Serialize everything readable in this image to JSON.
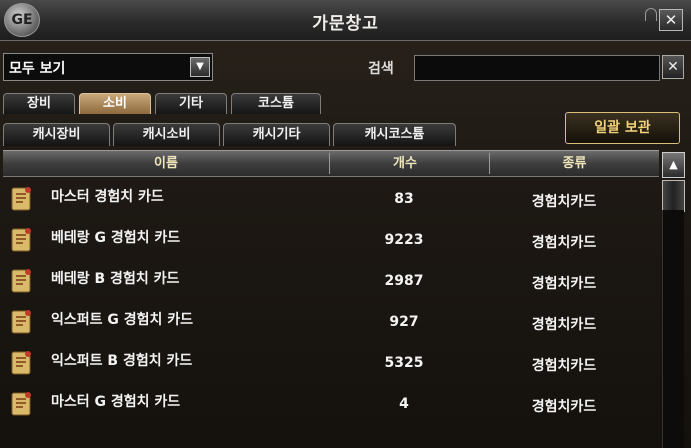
{
  "window": {
    "title": "가문창고",
    "logo_text": "GE"
  },
  "filter": {
    "dropdown_value": "모두 보기",
    "search_label": "검색",
    "search_value": ""
  },
  "tabs": [
    {
      "label": "장비",
      "active": false
    },
    {
      "label": "소비",
      "active": true
    },
    {
      "label": "기타",
      "active": false
    },
    {
      "label": "코스튬",
      "active": false
    }
  ],
  "subtabs": [
    {
      "label": "캐시장비"
    },
    {
      "label": "캐시소비"
    },
    {
      "label": "캐시기타"
    },
    {
      "label": "캐시코스튬"
    }
  ],
  "store_all_label": "일괄 보관",
  "table": {
    "headers": {
      "name": "이름",
      "count": "개수",
      "type": "종류"
    },
    "rows": [
      {
        "name": "마스터 경험치 카드",
        "count": "83",
        "type": "경험치카드"
      },
      {
        "name": "베테랑 G 경험치 카드",
        "count": "9223",
        "type": "경험치카드"
      },
      {
        "name": "베테랑 B 경험치 카드",
        "count": "2987",
        "type": "경험치카드"
      },
      {
        "name": "익스퍼트 G 경험치 카드",
        "count": "927",
        "type": "경험치카드"
      },
      {
        "name": "익스퍼트 B 경험치 카드",
        "count": "5325",
        "type": "경험치카드"
      },
      {
        "name": "마스터 G 경험치 카드",
        "count": "4",
        "type": "경험치카드"
      }
    ]
  },
  "icons": {
    "item": "scroll-card-icon",
    "close": "close-icon",
    "dropdown": "chevron-down-icon",
    "scroll_up": "arrow-up-icon"
  },
  "colors": {
    "accent_gold": "#f2d27a",
    "active_tab": "#b08f5e",
    "header_text": "#efe6bd"
  }
}
